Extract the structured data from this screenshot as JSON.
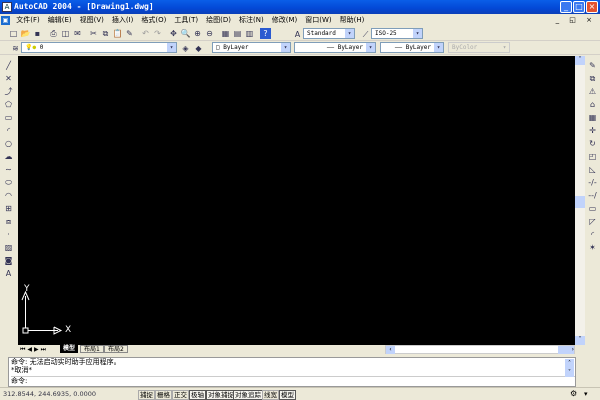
{
  "window": {
    "title": "AutoCAD 2004 - [Drawing1.dwg]"
  },
  "menu": [
    "文件(F)",
    "编辑(E)",
    "视图(V)",
    "插入(I)",
    "格式(O)",
    "工具(T)",
    "绘图(D)",
    "标注(N)",
    "修改(M)",
    "窗口(W)",
    "帮助(H)"
  ],
  "toolbar": {
    "text_style": "Standard",
    "dim_style": "ISO-25"
  },
  "properties": {
    "layer": "0",
    "color": "ByLayer",
    "linetype": "ByLayer",
    "lineweight": "ByLayer",
    "plotstyle": "ByColor"
  },
  "ucs": {
    "x": "X",
    "y": "Y"
  },
  "tabs": [
    "模型",
    "布局1",
    "布局2"
  ],
  "command": {
    "lines": [
      "命令: 无法启动实时助手应用程序。",
      "*取消*"
    ],
    "prompt": "命令:"
  },
  "status": {
    "coords": "312.8544, 244.6935, 0.0000",
    "buttons": [
      {
        "label": "捕捉",
        "on": false
      },
      {
        "label": "栅格",
        "on": false
      },
      {
        "label": "正交",
        "on": false
      },
      {
        "label": "极轴",
        "on": true
      },
      {
        "label": "对象捕捉",
        "on": true
      },
      {
        "label": "对象追踪",
        "on": true
      },
      {
        "label": "线宽",
        "on": false
      },
      {
        "label": "模型",
        "on": true
      }
    ]
  }
}
